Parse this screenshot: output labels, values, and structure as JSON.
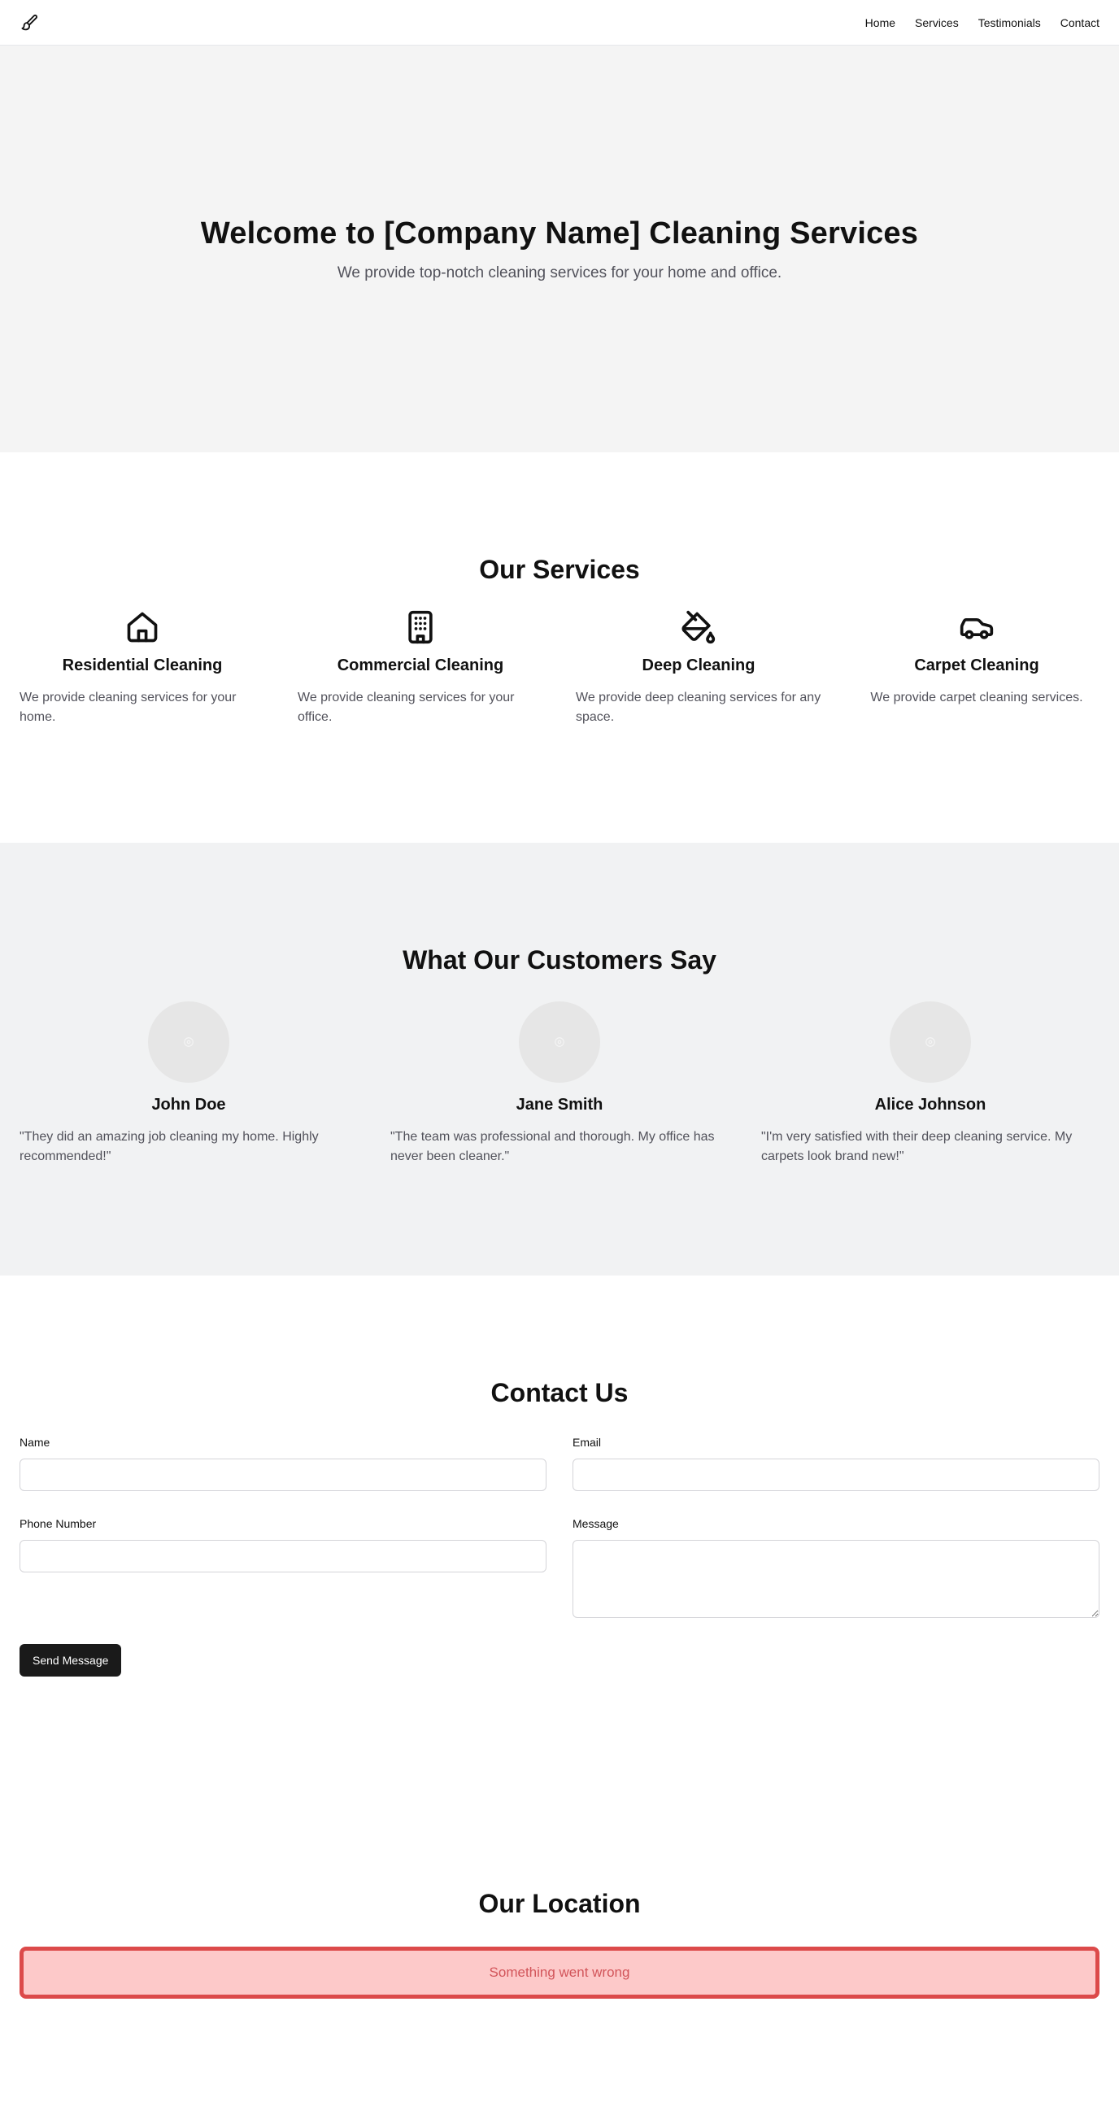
{
  "header": {
    "logo_icon": "paintbrush-icon",
    "nav": [
      "Home",
      "Services",
      "Testimonials",
      "Contact"
    ]
  },
  "hero": {
    "title": "Welcome to [Company Name] Cleaning Services",
    "subtitle": "We provide top-notch cleaning services for your home and office."
  },
  "services": {
    "title": "Our Services",
    "items": [
      {
        "icon": "home-icon",
        "title": "Residential Cleaning",
        "description": "We provide cleaning services for your home."
      },
      {
        "icon": "building-icon",
        "title": "Commercial Cleaning",
        "description": "We provide cleaning services for your office."
      },
      {
        "icon": "paint-bucket-icon",
        "title": "Deep Cleaning",
        "description": "We provide deep cleaning services for any space."
      },
      {
        "icon": "car-icon",
        "title": "Carpet Cleaning",
        "description": "We provide carpet cleaning services."
      }
    ]
  },
  "testimonials": {
    "title": "What Our Customers Say",
    "items": [
      {
        "name": "John Doe",
        "quote": "\"They did an amazing job cleaning my home. Highly recommended!\""
      },
      {
        "name": "Jane Smith",
        "quote": "\"The team was professional and thorough. My office has never been cleaner.\""
      },
      {
        "name": "Alice Johnson",
        "quote": "\"I'm very satisfied with their deep cleaning service. My carpets look brand new!\""
      }
    ]
  },
  "contact": {
    "title": "Contact Us",
    "fields": {
      "name_label": "Name",
      "name_value": "",
      "email_label": "Email",
      "email_value": "",
      "phone_label": "Phone Number",
      "phone_value": "",
      "message_label": "Message",
      "message_value": ""
    },
    "submit_label": "Send Message"
  },
  "location": {
    "title": "Our Location",
    "error_text": "Something went wrong"
  },
  "colors": {
    "hero_bg": "#f4f4f4",
    "testimonials_bg": "#f1f2f3",
    "button_bg": "#1a1a1a",
    "error_border": "#dc4a4a",
    "error_bg": "#fdc9c9",
    "error_text": "#d2555a",
    "muted_text": "#52525b"
  }
}
